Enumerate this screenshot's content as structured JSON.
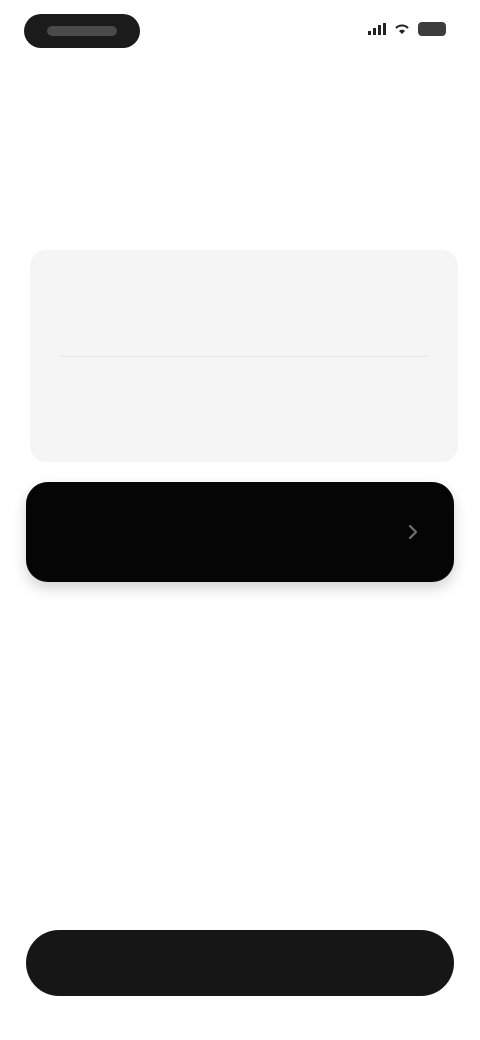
{
  "status_bar": {
    "time": "",
    "icons": [
      "signal-icon",
      "wifi-icon",
      "battery-icon"
    ]
  },
  "heading": {
    "text": ""
  },
  "options": [
    {
      "label": ""
    },
    {
      "label": ""
    }
  ],
  "selected_option": {
    "label": "",
    "icon": "chevron-right-icon"
  },
  "primary_button": {
    "label": ""
  },
  "colors": {
    "background": "#ffffff",
    "card": "#f5f5f5",
    "selected_row": "#050505",
    "button": "#161616"
  }
}
